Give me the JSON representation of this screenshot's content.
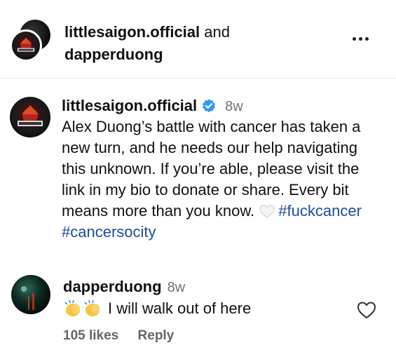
{
  "header": {
    "user1": "littlesaigon.official",
    "joiner": "and",
    "user2": "dapperduong",
    "more_icon": "more-horizontal-icon"
  },
  "caption": {
    "username": "littlesaigon.official",
    "verified_icon": "verified-badge-icon",
    "time": "8w",
    "text": "Alex Duong’s battle with cancer has taken a new turn, and he needs our help navigating this unknown. If you’re able, please visit the link in my bio to donate or share. Every bit means more than you know.",
    "heart_icon": "white-heart-icon",
    "hashtags": [
      "#fuckcancer",
      "#cancersocity"
    ]
  },
  "comment": {
    "username": "dapperduong",
    "time": "8w",
    "emoji_icon": "clapping-hands-icon",
    "text": "I will walk out of here",
    "likes": "105 likes",
    "reply": "Reply",
    "like_icon": "heart-outline-icon"
  },
  "colors": {
    "verified": "#3797f0",
    "hashtag": "#1b4d9c",
    "meta": "#737373"
  }
}
